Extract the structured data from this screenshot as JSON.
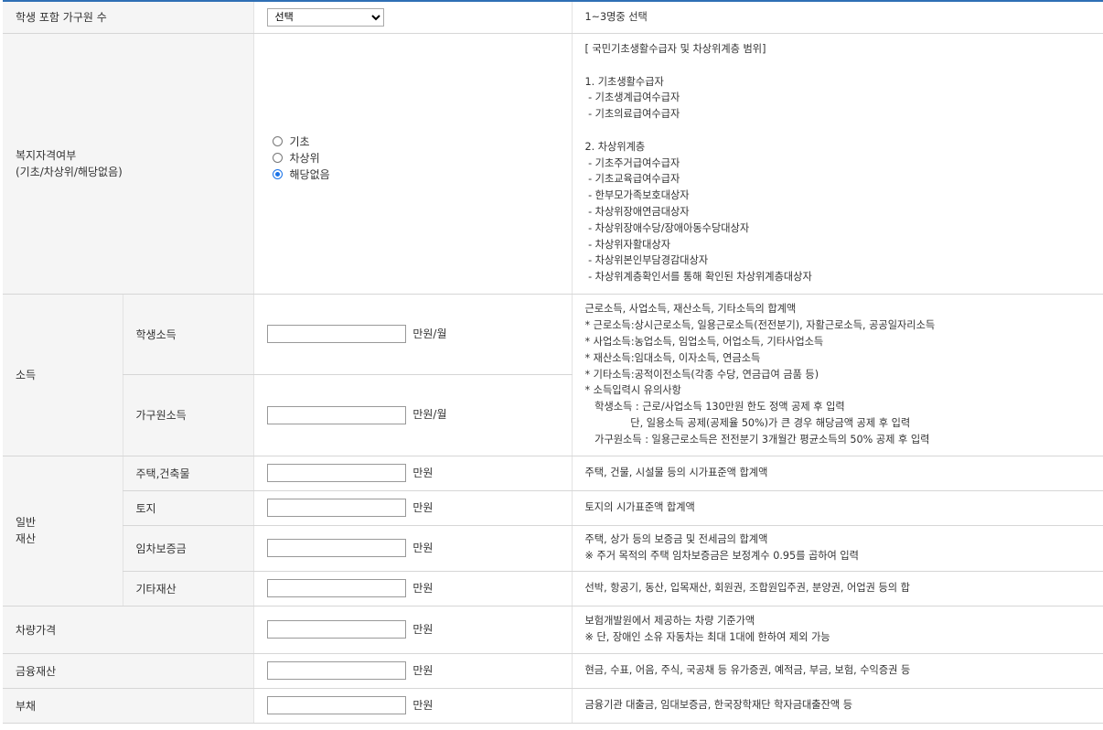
{
  "household": {
    "label": "학생 포함 가구원 수",
    "select_value": "선택",
    "desc": "1~3명중 선택"
  },
  "welfare": {
    "label_line1": "복지자격여부",
    "label_line2": "(기초/차상위/해당없음)",
    "options": [
      "기초",
      "차상위",
      "해당없음"
    ],
    "selected_index": 2,
    "desc_lines": [
      "[ 국민기초생활수급자 및 차상위계층 범위]",
      "",
      "1. 기초생활수급자",
      " - 기초생계급여수급자",
      " - 기초의료급여수급자",
      "",
      "2. 차상위계층",
      " - 기초주거급여수급자",
      " - 기초교육급여수급자",
      " - 한부모가족보호대상자",
      " - 차상위장애연금대상자",
      " - 차상위장애수당/장애아동수당대상자",
      " - 차상위자활대상자",
      " - 차상위본인부담경감대상자",
      " - 차상위계층확인서를 통해 확인된 차상위계층대상자"
    ]
  },
  "income": {
    "label": "소득",
    "student_label": "학생소득",
    "household_label": "가구원소득",
    "unit": "만원/월",
    "desc_lines": [
      "근로소득, 사업소득, 재산소득, 기타소득의 합계액",
      "* 근로소득:상시근로소득, 일용근로소득(전전분기), 자활근로소득, 공공일자리소득",
      "* 사업소득:농업소득, 임업소득, 어업소득, 기타사업소득",
      "* 재산소득:임대소득, 이자소득, 연금소득",
      "* 기타소득:공적이전소득(각종 수당, 연금급여 금품 등)",
      "* 소득입력시 유의사항",
      "   학생소득 : 근로/사업소득 130만원 한도 정액 공제 후 입력",
      "              단, 일용소득 공제(공제율 50%)가 큰 경우 해당금액 공제 후 입력",
      "   가구원소득 : 일용근로소득은 전전분기 3개월간 평균소득의 50% 공제 후 입력"
    ]
  },
  "property": {
    "label_line1": "일반",
    "label_line2": "재산",
    "unit": "만원",
    "rows": [
      {
        "label": "주택,건축물",
        "desc_lines": [
          "주택, 건물, 시설물 등의 시가표준액 합계액"
        ]
      },
      {
        "label": "토지",
        "desc_lines": [
          "토지의 시가표준액 합계액"
        ]
      },
      {
        "label": "임차보증금",
        "desc_lines": [
          "주택, 상가 등의 보증금 및 전세금의 합계액",
          "※ 주거 목적의 주택 임차보증금은 보정계수 0.95를 곱하여 입력"
        ]
      },
      {
        "label": "기타재산",
        "desc_lines": [
          "선박, 항공기, 동산, 입목재산, 회원권, 조합원입주권, 분양권, 어업권 등의 합"
        ]
      }
    ]
  },
  "vehicle": {
    "label": "차량가격",
    "unit": "만원",
    "desc_lines": [
      "보험개발원에서 제공하는 차량 기준가액",
      "※ 단, 장애인 소유 자동차는 최대 1대에 한하여 제외 가능"
    ]
  },
  "finance": {
    "label": "금융재산",
    "unit": "만원",
    "desc": "현금, 수표, 어음, 주식, 국공채 등 유가증권, 예적금, 부금, 보험, 수익증권 등"
  },
  "debt": {
    "label": "부채",
    "unit": "만원",
    "desc": "금융기관 대출금, 임대보증금, 한국장학재단 학자금대출잔액 등"
  }
}
